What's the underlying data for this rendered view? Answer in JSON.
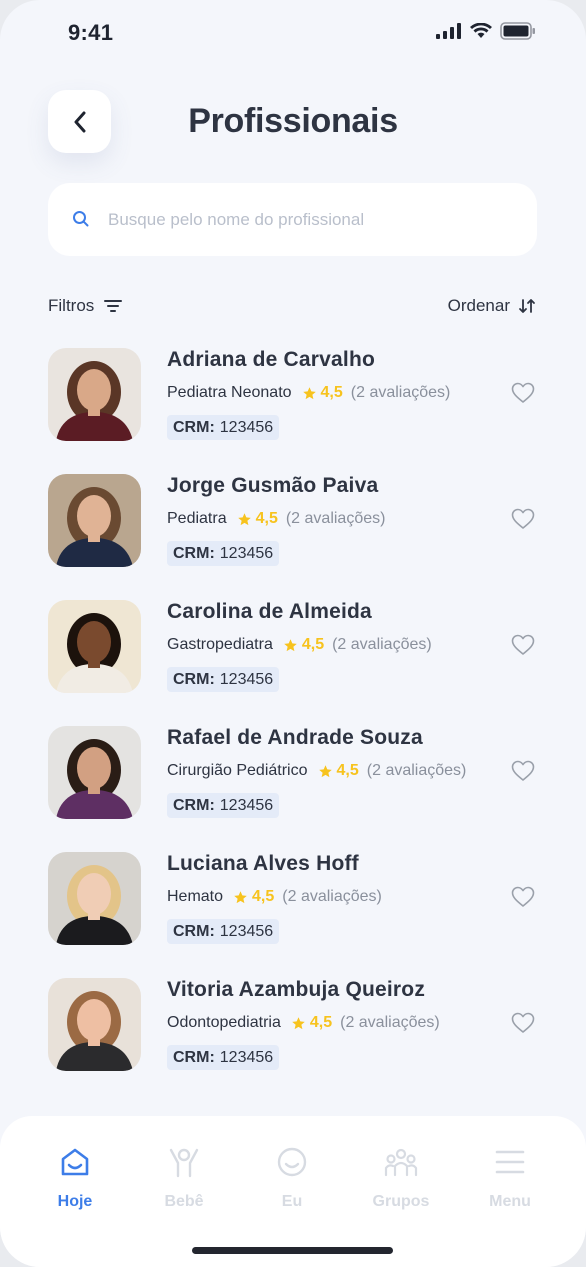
{
  "status": {
    "time": "9:41"
  },
  "header": {
    "title": "Profissionais"
  },
  "search": {
    "placeholder": "Busque pelo nome do profissional"
  },
  "toolbar": {
    "filters_label": "Filtros",
    "sort_label": "Ordenar"
  },
  "professionals": [
    {
      "name": "Adriana de Carvalho",
      "specialty": "Pediatra Neonato",
      "rating": "4,5",
      "reviews": "(2 avaliações)",
      "crm_label": "CRM:",
      "crm_value": "123456",
      "photo_bg": "#e9e4df",
      "hair": "#5a3626",
      "skin": "#d9a888",
      "shirt": "#5b1c24"
    },
    {
      "name": "Jorge Gusmão Paiva",
      "specialty": "Pediatra",
      "rating": "4,5",
      "reviews": "(2 avaliações)",
      "crm_label": "CRM:",
      "crm_value": "123456",
      "photo_bg": "#b9a68f",
      "hair": "#6a4a32",
      "skin": "#e0b395",
      "shirt": "#1f2a44"
    },
    {
      "name": "Carolina de Almeida",
      "specialty": "Gastropediatra",
      "rating": "4,5",
      "reviews": "(2 avaliações)",
      "crm_label": "CRM:",
      "crm_value": "123456",
      "photo_bg": "#efe6d3",
      "hair": "#1c120c",
      "skin": "#7a4a2e",
      "shirt": "#f1ece4"
    },
    {
      "name": "Rafael de Andrade Souza",
      "specialty": "Cirurgião Pediátrico",
      "rating": "4,5",
      "reviews": "(2 avaliações)",
      "crm_label": "CRM:",
      "crm_value": "123456",
      "photo_bg": "#e4e3e1",
      "hair": "#2a1d16",
      "skin": "#d2a082",
      "shirt": "#5e2f63"
    },
    {
      "name": "Luciana Alves Hoff",
      "specialty": "Hemato",
      "rating": "4,5",
      "reviews": "(2 avaliações)",
      "crm_label": "CRM:",
      "crm_value": "123456",
      "photo_bg": "#d6d3ce",
      "hair": "#e3c489",
      "skin": "#f0cdb5",
      "shirt": "#1b1b1e"
    },
    {
      "name": "Vitoria Azambuja Queiroz",
      "specialty": "Odontopediatria",
      "rating": "4,5",
      "reviews": "(2 avaliações)",
      "crm_label": "CRM:",
      "crm_value": "123456",
      "photo_bg": "#e8e1d9",
      "hair": "#9b6a44",
      "skin": "#eebfa3",
      "shirt": "#2b2b2d"
    }
  ],
  "nav": [
    {
      "label": "Hoje",
      "icon": "home-icon",
      "active": true
    },
    {
      "label": "Bebê",
      "icon": "baby-icon",
      "active": false
    },
    {
      "label": "Eu",
      "icon": "smile-icon",
      "active": false
    },
    {
      "label": "Grupos",
      "icon": "group-icon",
      "active": false
    },
    {
      "label": "Menu",
      "icon": "menu-icon",
      "active": false
    }
  ],
  "colors": {
    "accent": "#3d7de8",
    "star": "#f7c31e",
    "crm_bg": "#e4ebf8",
    "text": "#2e3442",
    "muted": "#8a909c",
    "nav_inactive": "#d7dbe2"
  }
}
